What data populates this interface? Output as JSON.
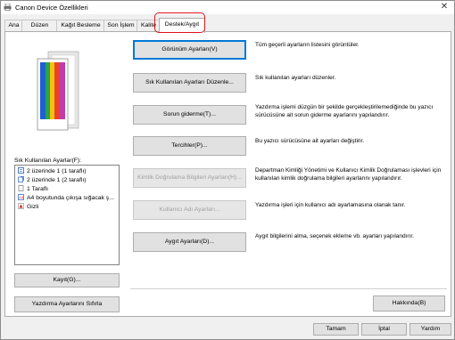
{
  "window": {
    "title": "Canon Device Özellikleri",
    "close_glyph": "✕"
  },
  "tabs": [
    {
      "label": "Ana"
    },
    {
      "label": "Düzen"
    },
    {
      "label": "Kağıt Besleme"
    },
    {
      "label": "Son İşlem"
    },
    {
      "label": "Kalite"
    },
    {
      "label": "Destek/Aygıt",
      "active": true
    }
  ],
  "favorites": {
    "label": "Sık Kullanılan Ayarlar(F):",
    "items": [
      {
        "icon": "one-sided-doc-icon",
        "label": "2 üzerinde 1 (1 taraflı)"
      },
      {
        "icon": "two-sided-doc-icon",
        "label": "2 üzerinde 1 (2 taraflı)"
      },
      {
        "icon": "blank-page-icon",
        "label": "1 Taraflı"
      },
      {
        "icon": "a4-size-icon",
        "label": "A4 boyutunda çıkışa sığacak ş..."
      },
      {
        "icon": "red-secure-icon",
        "label": "Gizli"
      }
    ],
    "save_button": "Kayıt(G)...",
    "reset_button": "Yazdırma Ayarlarını Sıfırla"
  },
  "actions": [
    {
      "label": "Görünüm Ayarları(V)",
      "desc": "Tüm geçerli ayarların listesini görüntüler.",
      "default": true,
      "disabled": false
    },
    {
      "label": "Sık Kullanılan Ayarları Düzenle...",
      "desc": "Sık kullanılan ayarları düzenler.",
      "default": false,
      "disabled": false
    },
    {
      "label": "Sorun giderme(T)...",
      "desc": "Yazdırma işlemi düzgün bir şekilde gerçekleştirilemediğinde bu yazıcı sürücüsüne ait sorun giderme ayarlarını yapılandırır.",
      "default": false,
      "disabled": false
    },
    {
      "label": "Tercihler(P)...",
      "desc": "Bu yazıcı sürücüsüne ait ayarları değiştirir.",
      "default": false,
      "disabled": false
    },
    {
      "label": "Kimlik Doğrulama Bilgileri Ayarları(H)...",
      "desc": "Departman Kimliği Yönetimi ve Kullanıcı Kimlik Doğrulaması işlevleri için kullanılan kimlik doğrulama bilgileri ayarlarını yapılandırır.",
      "default": false,
      "disabled": true
    },
    {
      "label": "Kullanıcı Adı Ayarları...",
      "desc": "Yazdırma işleri için kullanıcı adı ayarlamasına olanak tanır.",
      "default": false,
      "disabled": true
    },
    {
      "label": "Aygıt Ayarları(D)...",
      "desc": "Aygıt bilgilerini alma, seçenek ekleme vb. ayarları yapılandırır.",
      "default": false,
      "disabled": false
    }
  ],
  "about_button": "Hakkında(B)",
  "footer": {
    "ok": "Tamam",
    "cancel": "İptal",
    "help": "Yardım"
  }
}
